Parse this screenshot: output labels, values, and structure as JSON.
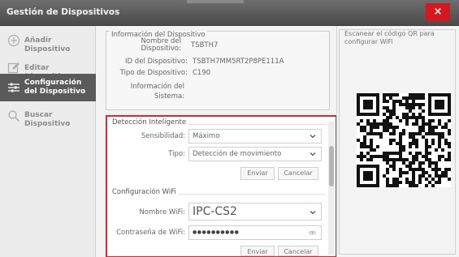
{
  "window": {
    "title": "Gestión de Dispositivos",
    "close_glyph": "×"
  },
  "sidebar": {
    "items": [
      {
        "label": "Añadir Dispositivo",
        "icon": "add-circle-icon",
        "active": false
      },
      {
        "label": "Editar Dispositivo",
        "icon": "edit-icon",
        "active": false
      },
      {
        "label": "Configuración del Dispositivo",
        "icon": "sliders-icon",
        "active": true
      },
      {
        "label": "Buscar Dispositivo",
        "icon": "search-icon",
        "active": false
      }
    ]
  },
  "info": {
    "legend": "Información del Dispositivo",
    "rows": [
      {
        "key": "Nombre del Dispositivo:",
        "value": "TSBTH7"
      },
      {
        "key": "ID del Dispositivo:",
        "value": "TSBTH7MM5RT2P8PE111A"
      },
      {
        "key": "Tipo de Dispositivo:",
        "value": "C190"
      },
      {
        "key": "Información del Sistema:",
        "value": ""
      }
    ]
  },
  "detection": {
    "title": "Detección Inteligente",
    "sensitivity_label": "Sensibilidad:",
    "sensitivity_value": "Máximo",
    "type_label": "Tipo:",
    "type_value": "Detección de movimiento",
    "send_label": "Enviar",
    "cancel_label": "Cancelar"
  },
  "wifi": {
    "title": "Configuración WiFi",
    "name_label": "Nombre WiFi:",
    "name_value": "IPC-CS2",
    "password_label": "Contraseña de WiFi:",
    "password_value": "●●●●●●●●●●",
    "send_label": "Enviar",
    "cancel_label": "Cancelar"
  },
  "qr": {
    "instruction": "Escanear el código QR para configurar WiFi"
  },
  "colors": {
    "accent_red": "#d92b2b",
    "close_red": "#d7171f",
    "active_nav": "#5a5a5a"
  }
}
